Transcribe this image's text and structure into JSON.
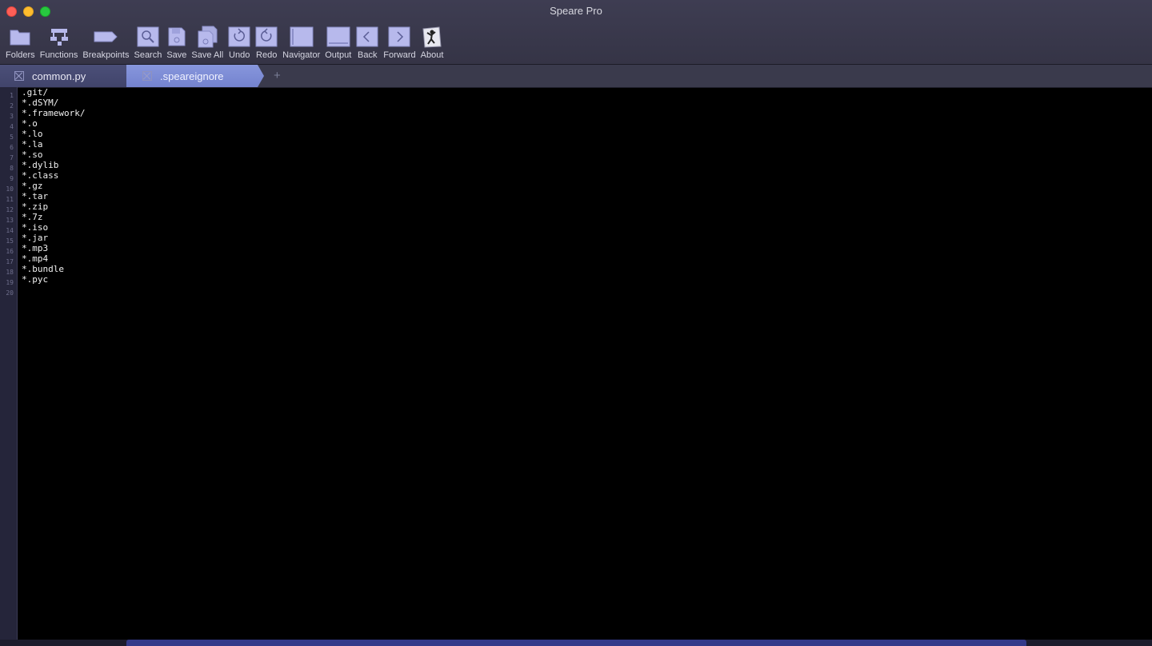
{
  "window": {
    "title": "Speare Pro",
    "accent_color": "#7483cf"
  },
  "toolbar": {
    "items": [
      {
        "label": "Folders",
        "icon": "folder-icon"
      },
      {
        "label": "Functions",
        "icon": "functions-icon"
      },
      {
        "label": "Breakpoints",
        "icon": "breakpoint-icon"
      },
      {
        "label": "Search",
        "icon": "search-icon"
      },
      {
        "label": "Save",
        "icon": "save-icon"
      },
      {
        "label": "Save All",
        "icon": "save-all-icon"
      },
      {
        "label": "Undo",
        "icon": "undo-icon"
      },
      {
        "label": "Redo",
        "icon": "redo-icon"
      },
      {
        "label": "Navigator",
        "icon": "navigator-icon"
      },
      {
        "label": "Output",
        "icon": "output-icon"
      },
      {
        "label": "Back",
        "icon": "back-icon"
      },
      {
        "label": "Forward",
        "icon": "forward-icon"
      },
      {
        "label": "About",
        "icon": "about-icon"
      }
    ]
  },
  "tabs": [
    {
      "label": "common.py",
      "active": false
    },
    {
      "label": ".speareignore",
      "active": true
    }
  ],
  "editor": {
    "line_numbers": [
      "1",
      "2",
      "3",
      "4",
      "5",
      "6",
      "7",
      "8",
      "9",
      "10",
      "11",
      "12",
      "13",
      "14",
      "15",
      "16",
      "17",
      "18",
      "19",
      "20"
    ],
    "lines": [
      ".git/",
      "*.dSYM/",
      "*.framework/",
      "*.o",
      "*.lo",
      "*.la",
      "*.so",
      "*.dylib",
      "*.class",
      "*.gz",
      "*.tar",
      "*.zip",
      "*.7z",
      "*.iso",
      "*.jar",
      "*.mp3",
      "*.mp4",
      "*.bundle",
      "*.pyc",
      ""
    ]
  }
}
